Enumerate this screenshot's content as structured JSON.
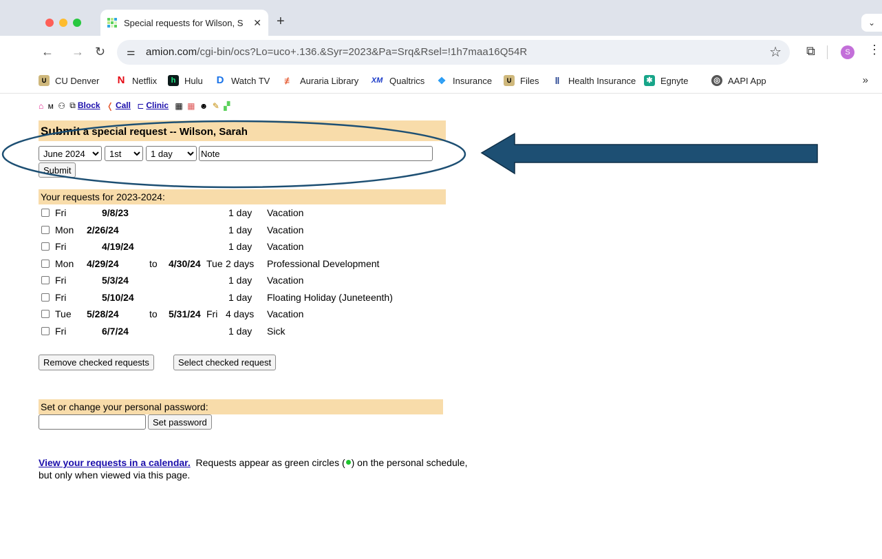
{
  "browser": {
    "tab_title": "Special requests for Wilson, S",
    "tab_close": "✕",
    "new_tab": "+",
    "tab_menu": "⌄",
    "url_host": "amion.com",
    "url_path": "/cgi-bin/ocs?Lo=uco+.136.&Syr=2023&Pa=Srq&Rsel=!1h7maa16Q54R",
    "profile_initial": "S",
    "bookmarks": [
      {
        "label": "CU Denver",
        "icon": "cu-icon"
      },
      {
        "label": "Netflix",
        "icon": "netflix-icon"
      },
      {
        "label": "Hulu",
        "icon": "hulu-icon"
      },
      {
        "label": "Watch TV",
        "icon": "watch-tv-icon"
      },
      {
        "label": "Auraria Library",
        "icon": "library-icon"
      },
      {
        "label": "Qualtrics",
        "icon": "qualtrics-icon"
      },
      {
        "label": "Insurance",
        "icon": "insurance-icon"
      },
      {
        "label": "Files",
        "icon": "files-icon"
      },
      {
        "label": "Health Insurance",
        "icon": "health-insurance-icon"
      },
      {
        "label": "Egnyte",
        "icon": "egnyte-icon"
      },
      {
        "label": "AAPI App",
        "icon": "globe-icon"
      }
    ],
    "bookmarks_more": "»",
    "qualtrics_prefix": "XM"
  },
  "nav_links": {
    "block": "Block",
    "call": "Call",
    "clinic": "Clinic"
  },
  "submit_section": {
    "title_lead": "Submit",
    "title_rest": " a special request -- Wilson, Sarah",
    "month_value": "June 2024",
    "day_value": "1st",
    "length_value": "1 day",
    "note_value": "Note",
    "submit_label": "Submit"
  },
  "requests_section": {
    "header": "Your requests for 2023-2024:",
    "rows": [
      {
        "dow": "Fri",
        "start": "9/8/23",
        "to": "",
        "end": "",
        "dow2": "",
        "length": "1 day",
        "type": "Vacation"
      },
      {
        "dow": "Mon",
        "start": "2/26/24",
        "to": "",
        "end": "",
        "dow2": "",
        "length": "1 day",
        "type": "Vacation"
      },
      {
        "dow": "Fri",
        "start": "4/19/24",
        "to": "",
        "end": "",
        "dow2": "",
        "length": "1 day",
        "type": "Vacation"
      },
      {
        "dow": "Mon",
        "start": "4/29/24",
        "to": "to",
        "end": "4/30/24",
        "dow2": "Tue",
        "length": "2 days",
        "type": "Professional Development"
      },
      {
        "dow": "Fri",
        "start": "5/3/24",
        "to": "",
        "end": "",
        "dow2": "",
        "length": "1 day",
        "type": "Vacation"
      },
      {
        "dow": "Fri",
        "start": "5/10/24",
        "to": "",
        "end": "",
        "dow2": "",
        "length": "1 day",
        "type": "Floating Holiday (Juneteenth)"
      },
      {
        "dow": "Tue",
        "start": "5/28/24",
        "to": "to",
        "end": "5/31/24",
        "dow2": "Fri",
        "length": "4 days",
        "type": "Vacation"
      },
      {
        "dow": "Fri",
        "start": "6/7/24",
        "to": "",
        "end": "",
        "dow2": "",
        "length": "1 day",
        "type": "Sick"
      }
    ],
    "remove_label": "Remove checked requests",
    "select_label": "Select checked request"
  },
  "password_section": {
    "header": "Set or change your personal password:",
    "password_value": "",
    "set_label": "Set password"
  },
  "footer": {
    "link_text": "View your requests in a calendar.",
    "text_before_dot": "  Requests appear as green circles (",
    "text_after_dot": ") on the personal schedule, but only when viewed via this page."
  },
  "colors": {
    "band": "#f8dcaa",
    "link": "#1a0dab",
    "annotation": "#1d4f73",
    "green_dot": "#1cc42d"
  }
}
